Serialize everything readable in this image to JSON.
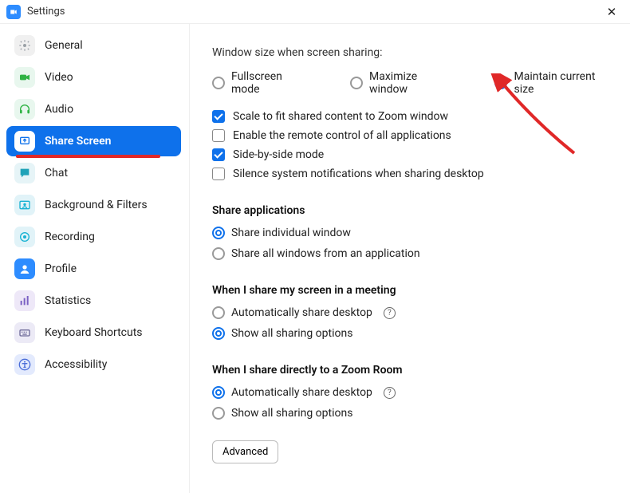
{
  "titlebar": {
    "title": "Settings"
  },
  "sidebar": {
    "items": [
      {
        "id": "general",
        "label": "General",
        "icon": "gear",
        "bg": "#F0F0F0",
        "fg": "#9AA0A6"
      },
      {
        "id": "video",
        "label": "Video",
        "icon": "video",
        "bg": "#E8F7EE",
        "fg": "#2FB344"
      },
      {
        "id": "audio",
        "label": "Audio",
        "icon": "headphones",
        "bg": "#E8F7EE",
        "fg": "#2FB344"
      },
      {
        "id": "share-screen",
        "label": "Share Screen",
        "icon": "share",
        "bg": "#0E71EB",
        "fg": "#FFFFFF",
        "active": true,
        "underline": true
      },
      {
        "id": "chat",
        "label": "Chat",
        "icon": "chat",
        "bg": "#E6F4F7",
        "fg": "#1FA2B8"
      },
      {
        "id": "background",
        "label": "Background & Filters",
        "icon": "bgf",
        "bg": "#E1F3F8",
        "fg": "#19B3D3"
      },
      {
        "id": "recording",
        "label": "Recording",
        "icon": "record",
        "bg": "#E1F3F8",
        "fg": "#19B3D3"
      },
      {
        "id": "profile",
        "label": "Profile",
        "icon": "profile",
        "bg": "#2D8CFF",
        "fg": "#FFFFFF"
      },
      {
        "id": "statistics",
        "label": "Statistics",
        "icon": "stats",
        "bg": "#EEE8F8",
        "fg": "#7B61C4"
      },
      {
        "id": "keyboard",
        "label": "Keyboard Shortcuts",
        "icon": "keyboard",
        "bg": "#ECEAF6",
        "fg": "#6E6B99"
      },
      {
        "id": "accessibility",
        "label": "Accessibility",
        "icon": "access",
        "bg": "#E3EAFD",
        "fg": "#4A6DD8"
      }
    ]
  },
  "content": {
    "windowSize": {
      "heading": "Window size when screen sharing:",
      "options": [
        {
          "id": "fullscreen",
          "label": "Fullscreen mode",
          "selected": false
        },
        {
          "id": "maximize",
          "label": "Maximize window",
          "selected": false
        },
        {
          "id": "maintain",
          "label": "Maintain current size",
          "selected": true
        }
      ]
    },
    "checks": [
      {
        "id": "scale",
        "label": "Scale to fit shared content to Zoom window",
        "checked": true
      },
      {
        "id": "remote",
        "label": "Enable the remote control of all applications",
        "checked": false
      },
      {
        "id": "sbs",
        "label": "Side-by-side mode",
        "checked": true
      },
      {
        "id": "silence",
        "label": "Silence system notifications when sharing desktop",
        "checked": false
      }
    ],
    "shareApps": {
      "title": "Share applications",
      "options": [
        {
          "id": "indiv",
          "label": "Share individual window",
          "selected": true
        },
        {
          "id": "allwin",
          "label": "Share all windows from an application",
          "selected": false
        }
      ]
    },
    "meeting": {
      "title": "When I share my screen in a meeting",
      "options": [
        {
          "id": "autodesk1",
          "label": "Automatically share desktop",
          "help": true,
          "selected": false
        },
        {
          "id": "showall1",
          "label": "Show all sharing options",
          "selected": true
        }
      ]
    },
    "zoomRoom": {
      "title": "When I share directly to a Zoom Room",
      "options": [
        {
          "id": "autodesk2",
          "label": "Automatically share desktop",
          "help": true,
          "selected": true
        },
        {
          "id": "showall2",
          "label": "Show all sharing options",
          "selected": false
        }
      ]
    },
    "advanced": "Advanced"
  }
}
